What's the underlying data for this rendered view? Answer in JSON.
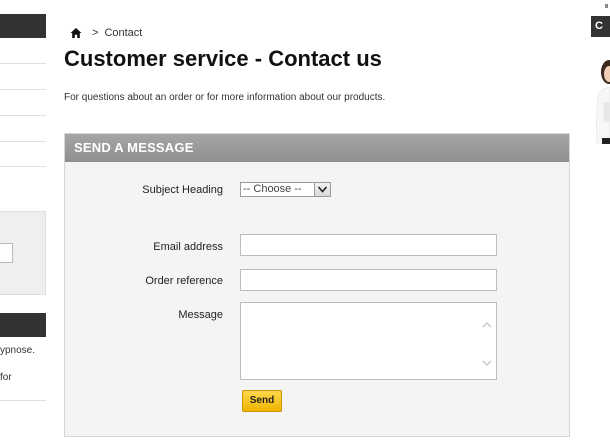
{
  "sidebar": {
    "text_line_1": "ypnose.",
    "text_line_2": "for"
  },
  "breadcrumb": {
    "separator": ">",
    "current": "Contact"
  },
  "page": {
    "title": "Customer service - Contact us",
    "intro": "For questions about an order or for more information about our products."
  },
  "form": {
    "heading": "SEND A MESSAGE",
    "subject_label": "Subject Heading",
    "subject_selected": "-- Choose --",
    "email_label": "Email address",
    "email_value": "",
    "order_label": "Order reference",
    "order_value": "",
    "message_label": "Message",
    "message_value": "",
    "send_label": "Send"
  },
  "right_panel": {
    "header_fragment": "C"
  },
  "colors": {
    "accent_button": "#f5c518",
    "panel_header": "#999999",
    "dark_bar": "#333333"
  },
  "icons": {
    "home": "home-icon",
    "select_arrow": "chevron-down-icon",
    "scroll_up": "chevron-up-icon",
    "scroll_down": "chevron-down-icon"
  }
}
